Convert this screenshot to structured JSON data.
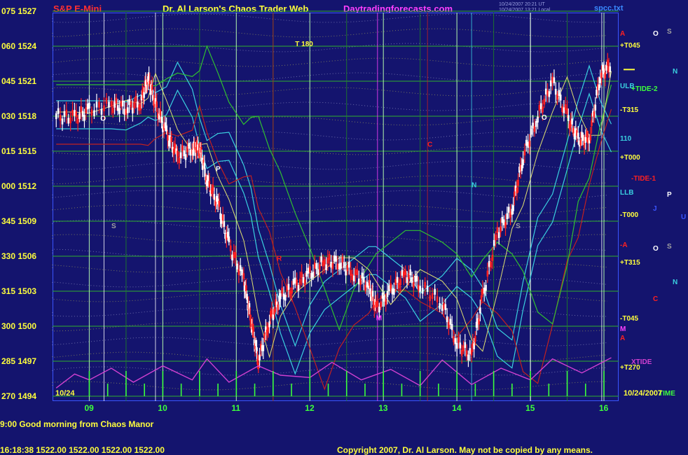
{
  "header": {
    "left_title": "S&P E-Mini",
    "center_title": "Dr. Al Larson's Chaos Trader Web",
    "site": "Daytradingforecasts.com",
    "timestamp_utc": "10/24/2007 20:21 UT",
    "timestamp_local": "10/24/2007 13:21 Local",
    "file": "spcc.txt"
  },
  "footer": {
    "greeting": "9:00 Good morning from Chaos Manor",
    "quote_line": "16:18:38  1522.00 1522.00 1522.00 1522.00",
    "copyright": "Copyright 2007, Dr. Al Larson. May not be copied by any means."
  },
  "colors": {
    "background": "#14146e",
    "frame": "#3a55ff",
    "grid_green": "#2fb02f",
    "price_labels": "#ffff3c",
    "hour_labels": "#3cff3c",
    "candles_up": "#ffffff",
    "candles_down": "#ff2020",
    "xtide": "#d040d0",
    "bands": "#3ad0e0",
    "red_flux": "#c02020",
    "green_flux": "#30c030"
  },
  "chart_data": {
    "type": "candlestick",
    "title": "S&P E-Mini",
    "date_label": "10/24",
    "date_label_right": "10/24/2007",
    "x": [
      "09",
      "10",
      "11",
      "12",
      "13",
      "14",
      "15",
      "16"
    ],
    "y_labels": [
      {
        "angle": "075",
        "price": 1527
      },
      {
        "angle": "060",
        "price": 1524
      },
      {
        "angle": "045",
        "price": 1521
      },
      {
        "angle": "030",
        "price": 1518
      },
      {
        "angle": "015",
        "price": 1515
      },
      {
        "angle": "000",
        "price": 1512
      },
      {
        "angle": "345",
        "price": 1509
      },
      {
        "angle": "330",
        "price": 1506
      },
      {
        "angle": "315",
        "price": 1503
      },
      {
        "angle": "300",
        "price": 1500
      },
      {
        "angle": "285",
        "price": 1497
      },
      {
        "angle": "270",
        "price": 1494
      }
    ],
    "ylim": [
      1494,
      1527
    ],
    "xlim": [
      8.5,
      16.2
    ],
    "last_quote": {
      "time": "16:18:38",
      "open": 1522.0,
      "high": 1522.0,
      "low": 1522.0,
      "close": 1522.0
    },
    "series": [
      {
        "name": "price",
        "values": [
          [
            8.55,
            1518.0
          ],
          [
            8.8,
            1517.9
          ],
          [
            9.0,
            1518.5
          ],
          [
            9.3,
            1519.0
          ],
          [
            9.5,
            1518.7
          ],
          [
            9.7,
            1519.2
          ],
          [
            9.8,
            1521.3
          ],
          [
            9.9,
            1519.0
          ],
          [
            10.05,
            1516.5
          ],
          [
            10.2,
            1514.6
          ],
          [
            10.4,
            1515.2
          ],
          [
            10.5,
            1515.3
          ],
          [
            10.6,
            1512.5
          ],
          [
            10.75,
            1510.5
          ],
          [
            10.9,
            1507.0
          ],
          [
            11.1,
            1504.0
          ],
          [
            11.2,
            1500.5
          ],
          [
            11.3,
            1497.0
          ],
          [
            11.45,
            1500.5
          ],
          [
            11.6,
            1502.5
          ],
          [
            11.8,
            1503.5
          ],
          [
            12.0,
            1504.5
          ],
          [
            12.2,
            1505.5
          ],
          [
            12.4,
            1505.5
          ],
          [
            12.6,
            1504.5
          ],
          [
            12.8,
            1503.5
          ],
          [
            12.9,
            1501.5
          ],
          [
            13.1,
            1503.0
          ],
          [
            13.3,
            1504.5
          ],
          [
            13.5,
            1503.5
          ],
          [
            13.8,
            1502.0
          ],
          [
            14.0,
            1498.5
          ],
          [
            14.2,
            1497.5
          ],
          [
            14.35,
            1502.5
          ],
          [
            14.55,
            1508.0
          ],
          [
            14.75,
            1510.0
          ],
          [
            14.9,
            1514.5
          ],
          [
            15.1,
            1518.0
          ],
          [
            15.3,
            1521.0
          ],
          [
            15.5,
            1518.0
          ],
          [
            15.65,
            1516.0
          ],
          [
            15.8,
            1516.0
          ],
          [
            15.95,
            1521.5
          ],
          [
            16.1,
            1522.5
          ]
        ]
      },
      {
        "name": "xtide",
        "values": [
          [
            8.55,
            1494.7
          ],
          [
            8.8,
            1495.9
          ],
          [
            9.0,
            1495.4
          ],
          [
            9.3,
            1496.4
          ],
          [
            9.6,
            1495.2
          ],
          [
            10.0,
            1496.6
          ],
          [
            10.4,
            1495.4
          ],
          [
            10.6,
            1497.2
          ],
          [
            10.9,
            1495.2
          ],
          [
            11.3,
            1496.6
          ],
          [
            11.6,
            1495.8
          ],
          [
            12.0,
            1495.6
          ],
          [
            12.3,
            1496.9
          ],
          [
            12.7,
            1495.4
          ],
          [
            13.1,
            1496.3
          ],
          [
            13.5,
            1494.9
          ],
          [
            13.8,
            1497.1
          ],
          [
            14.2,
            1495.0
          ],
          [
            14.6,
            1496.4
          ],
          [
            15.0,
            1495.4
          ],
          [
            15.3,
            1497.2
          ],
          [
            15.7,
            1496.0
          ],
          [
            16.1,
            1497.3
          ]
        ]
      }
    ],
    "annotations": [
      {
        "text": "O",
        "x": 9.15,
        "y": 1517.6,
        "color": "#ffffff"
      },
      {
        "text": "P",
        "x": 10.72,
        "y": 1513.3,
        "color": "#ffffff"
      },
      {
        "text": "S",
        "x": 9.3,
        "y": 1508.4,
        "color": "#a0a0a0"
      },
      {
        "text": "T 180",
        "x": 11.8,
        "y": 1524.0,
        "color": "#ffff3c"
      },
      {
        "text": "C",
        "x": 13.6,
        "y": 1515.4,
        "color": "#ff2020"
      },
      {
        "text": "N",
        "x": 14.2,
        "y": 1511.9,
        "color": "#3ad0e0"
      },
      {
        "text": "M",
        "x": 12.9,
        "y": 1500.5,
        "color": "#ff40ff"
      },
      {
        "text": "O",
        "x": 15.15,
        "y": 1517.7,
        "color": "#ffffff"
      },
      {
        "text": "S",
        "x": 14.8,
        "y": 1508.4,
        "color": "#a0a0a0"
      },
      {
        "text": "R",
        "x": 11.55,
        "y": 1505.6,
        "color": "#ff2020"
      }
    ],
    "right_labels": [
      {
        "text": "A",
        "y": 1525.0,
        "color": "#ff2020"
      },
      {
        "text": "+T045",
        "y": 1524.0,
        "color": "#ffff3c"
      },
      {
        "text": "ULB",
        "y": 1520.5,
        "color": "#3ad0e0"
      },
      {
        "text": "+TIDE-2",
        "y": 1520.3,
        "color": "#3cff3c"
      },
      {
        "text": "-T315",
        "y": 1518.5,
        "color": "#ffff3c"
      },
      {
        "text": "110",
        "y": 1516.0,
        "color": "#3ad0e0"
      },
      {
        "text": "+T000",
        "y": 1514.4,
        "color": "#ffff3c"
      },
      {
        "text": "-TIDE-1",
        "y": 1512.6,
        "color": "#ff2020"
      },
      {
        "text": "LLB",
        "y": 1511.4,
        "color": "#3ad0e0"
      },
      {
        "text": "-T000",
        "y": 1509.5,
        "color": "#ffff3c"
      },
      {
        "text": "-A",
        "y": 1506.9,
        "color": "#ff2020"
      },
      {
        "text": "+T315",
        "y": 1505.4,
        "color": "#ffff3c"
      },
      {
        "text": "-T045",
        "y": 1500.6,
        "color": "#ffff3c"
      },
      {
        "text": "M",
        "y": 1499.7,
        "color": "#ff40ff"
      },
      {
        "text": "A",
        "y": 1498.9,
        "color": "#ff2020"
      },
      {
        "text": "XTIDE",
        "y": 1496.9,
        "color": "#d040d0"
      },
      {
        "text": "+T270",
        "y": 1496.4,
        "color": "#ffff3c"
      },
      {
        "text": "TIME",
        "y": 1494.2,
        "color": "#3cff3c"
      }
    ],
    "planet_glyphs": [
      {
        "text": "O",
        "col": 1,
        "y": 1525.0,
        "color": "#ffffff"
      },
      {
        "text": "S",
        "col": 2,
        "y": 1525.2,
        "color": "#a0a0a0"
      },
      {
        "text": "N",
        "col": 3,
        "y": 1521.8,
        "color": "#3ad0e0"
      },
      {
        "text": "P",
        "col": 2,
        "y": 1511.2,
        "color": "#ffffff"
      },
      {
        "text": "J",
        "col": 1,
        "y": 1510.0,
        "color": "#3a55ff"
      },
      {
        "text": "U",
        "col": 4,
        "y": 1509.3,
        "color": "#3a55ff"
      },
      {
        "text": "O",
        "col": 1,
        "y": 1506.6,
        "color": "#ffffff"
      },
      {
        "text": "S",
        "col": 2,
        "y": 1506.8,
        "color": "#a0a0a0"
      },
      {
        "text": "N",
        "col": 3,
        "y": 1503.7,
        "color": "#3ad0e0"
      },
      {
        "text": "C",
        "col": 1,
        "y": 1502.3,
        "color": "#ff2020"
      }
    ]
  }
}
